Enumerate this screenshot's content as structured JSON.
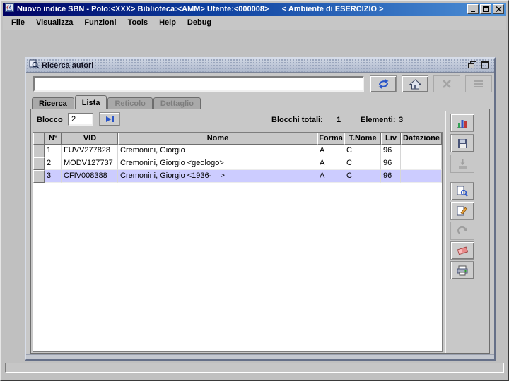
{
  "window": {
    "title": "Nuovo indice SBN - Polo:<XXX> Biblioteca:<AMM> Utente:<000008>      < Ambiente di ESERCIZIO >"
  },
  "menu": {
    "items": [
      "File",
      "Visualizza",
      "Funzioni",
      "Tools",
      "Help",
      "Debug"
    ]
  },
  "frame": {
    "title": "Ricerca autori",
    "search": {
      "value": ""
    },
    "search_buttons": [
      {
        "name": "refresh",
        "enabled": true
      },
      {
        "name": "home",
        "enabled": true
      },
      {
        "name": "cancel",
        "enabled": false
      },
      {
        "name": "list",
        "enabled": false
      }
    ],
    "tabs": [
      {
        "label": "Ricerca",
        "state": "enabled"
      },
      {
        "label": "Lista",
        "state": "selected"
      },
      {
        "label": "Reticolo",
        "state": "disabled"
      },
      {
        "label": "Dettaglio",
        "state": "disabled"
      }
    ],
    "lista": {
      "blocco_label": "Blocco",
      "blocco_value": "2",
      "blocchi_totali_label": "Blocchi totali:",
      "blocchi_totali_value": "1",
      "elementi_label": "Elementi:",
      "elementi_value": "3",
      "table": {
        "columns": [
          "",
          "N°",
          "VID",
          "Nome",
          "Forma",
          "T.Nome",
          "Liv",
          "Datazione"
        ],
        "rows": [
          {
            "n": "1",
            "vid": "FUVV277828",
            "nome": "Cremonini, Giorgio",
            "forma": "A",
            "t_nome": "C",
            "liv": "96",
            "datazione": ""
          },
          {
            "n": "2",
            "vid": "MODV127737",
            "nome": "Cremonini, Giorgio <geologo>",
            "forma": "A",
            "t_nome": "C",
            "liv": "96",
            "datazione": ""
          },
          {
            "n": "3",
            "vid": "CFIV008388",
            "nome": "Cremonini, Giorgio <1936-    >",
            "forma": "A",
            "t_nome": "C",
            "liv": "96",
            "datazione": "",
            "selected": true
          }
        ]
      }
    },
    "side_buttons": [
      {
        "name": "chart",
        "enabled": true
      },
      {
        "name": "export",
        "enabled": true
      },
      {
        "name": "import",
        "enabled": false
      },
      {
        "name": "view",
        "enabled": true
      },
      {
        "name": "edit",
        "enabled": true
      },
      {
        "name": "undo",
        "enabled": false
      },
      {
        "name": "erase",
        "enabled": true
      },
      {
        "name": "print",
        "enabled": true
      }
    ]
  },
  "colors": {
    "selection": "#ccccff",
    "titlebar_start": "#000062",
    "titlebar_end": "#4c8fd6",
    "background": "#c0c0c0"
  }
}
